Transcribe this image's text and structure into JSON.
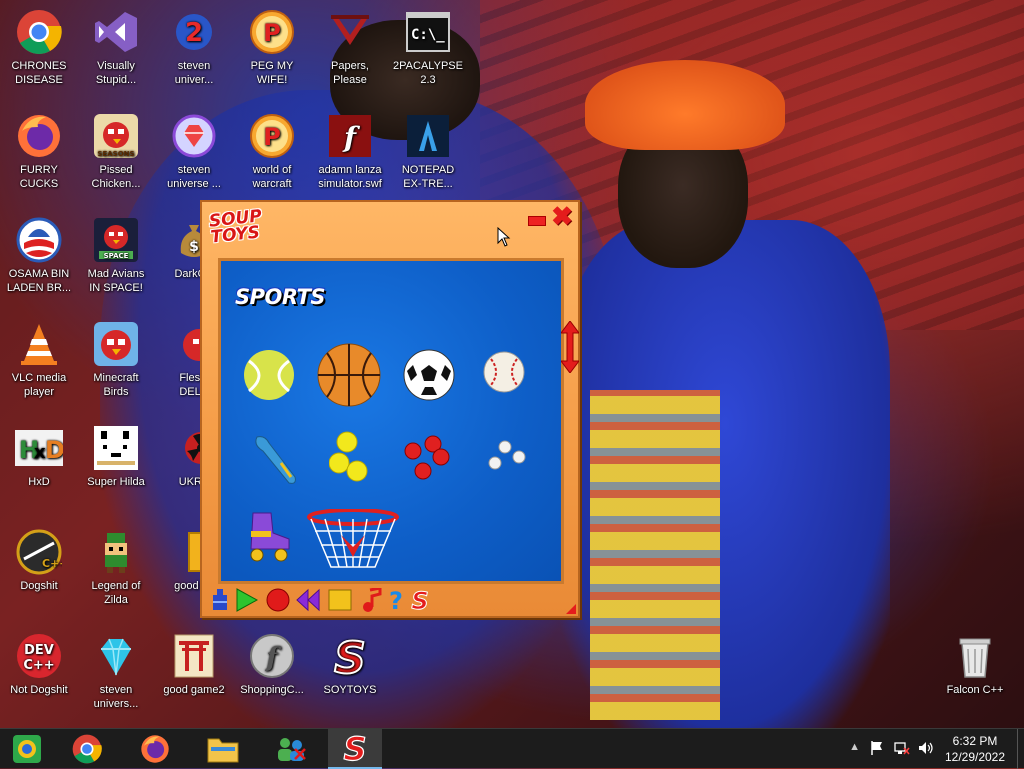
{
  "desktop": {
    "icons": [
      {
        "label": "CHRONES\nDISEASE",
        "icon": "chrome-icon"
      },
      {
        "label": "Visually\nStupid...",
        "icon": "visual-studio-icon"
      },
      {
        "label": "steven\nuniver...",
        "icon": "steven-universe-2-icon"
      },
      {
        "label": "PEG MY WIFE!",
        "icon": "pegs-icon"
      },
      {
        "label": "Papers,\nPlease",
        "icon": "papers-please-icon"
      },
      {
        "label": "2PACALYPSE\n2.3",
        "icon": "terminal-icon"
      },
      {
        "label": "FURRY CUCKS",
        "icon": "firefox-icon"
      },
      {
        "label": "Pissed\nChicken...",
        "icon": "angry-birds-seasons-icon"
      },
      {
        "label": "steven\nuniverse ...",
        "icon": "gem-icon"
      },
      {
        "label": "world of\nwarcraft",
        "icon": "pegs-icon"
      },
      {
        "label": "adamn lanza\nsimulator.swf",
        "icon": "flash-icon"
      },
      {
        "label": "NOTEPAD\nEX-TRE...",
        "icon": "notepad-icon"
      },
      {
        "label": "OSAMA BIN\nLADEN BR...",
        "icon": "obama-logo-icon"
      },
      {
        "label": "Mad Avians\nIN SPACE!",
        "icon": "angry-birds-space-icon"
      },
      {
        "label": "DarkOK",
        "icon": "money-bag-icon"
      },
      {
        "label": "VLC media\nplayer",
        "icon": "vlc-icon"
      },
      {
        "label": "Minecraft\nBirds",
        "icon": "angry-birds-icon"
      },
      {
        "label": "Fleshl\nDELU",
        "icon": "red-bird-icon"
      },
      {
        "label": "HxD",
        "icon": "hxd-icon"
      },
      {
        "label": "Super Hilda",
        "icon": "pixel-cat-icon"
      },
      {
        "label": "UKRA",
        "icon": "radiation-icon"
      },
      {
        "label": "Dogshit",
        "icon": "dev-tool-icon"
      },
      {
        "label": "Legend of\nZilda",
        "icon": "pixel-hero-icon"
      },
      {
        "label": "good ga",
        "icon": "box-icon"
      },
      {
        "label": "Not Dogshit",
        "icon": "dev-cpp-icon"
      },
      {
        "label": "steven\nunivers...",
        "icon": "diamond-icon"
      },
      {
        "label": "good game2",
        "icon": "torii-icon"
      },
      {
        "label": "ShoppingC...",
        "icon": "flash-ball-icon"
      },
      {
        "label": "SOYTOYS",
        "icon": "souptoys-icon"
      },
      {
        "label": "Falcon C++",
        "icon": "recycle-bin-icon"
      }
    ]
  },
  "souptoys": {
    "logo": "SOUP\nTOYS",
    "category": "SPORTS",
    "toys": [
      "tennis ball",
      "basketball",
      "soccer ball",
      "baseball",
      "blue bat",
      "yellow balls",
      "red balls",
      "white balls",
      "roller skate",
      "basketball hoop"
    ],
    "toolbar": [
      "bucket",
      "play",
      "record",
      "rewind",
      "stop",
      "music",
      "help",
      "soup-logo"
    ],
    "close": "✖"
  },
  "taskbar": {
    "apps": [
      "souptoys-taskbar-icon",
      "chrome-icon",
      "firefox-icon",
      "file-explorer-icon",
      "people-icon",
      "souptoys-icon"
    ],
    "time": "6:32 PM",
    "date": "12/29/2022"
  }
}
